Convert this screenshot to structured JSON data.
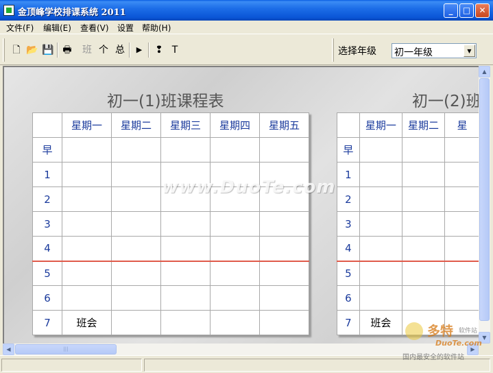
{
  "window": {
    "title": "金顶峰学校排课系统  2011",
    "minimize": "_",
    "maximize": "□",
    "close": "✕"
  },
  "menu": [
    {
      "label": "文件(F)"
    },
    {
      "label": "编辑(E)"
    },
    {
      "label": "查看(V)"
    },
    {
      "label": "设置"
    },
    {
      "label": "帮助(H)"
    }
  ],
  "toolbar": {
    "new": "🗋",
    "open": "📂",
    "save": "💾",
    "print": "🖶",
    "class_view": "班",
    "individual_view": "个",
    "total_view": "总",
    "play": "▶",
    "help": "❢",
    "text": "T",
    "grade_label": "选择年级",
    "grade_value": "初一年级"
  },
  "schedules": [
    {
      "title": "初一(1)班课程表",
      "days": [
        "星期一",
        "星期二",
        "星期三",
        "星期四",
        "星期五"
      ],
      "periods": [
        "早",
        "1",
        "2",
        "3",
        "4",
        "5",
        "6",
        "7"
      ],
      "cells": [
        [
          "",
          "",
          "",
          "",
          ""
        ],
        [
          "",
          "",
          "",
          "",
          ""
        ],
        [
          "",
          "",
          "",
          "",
          ""
        ],
        [
          "",
          "",
          "",
          "",
          ""
        ],
        [
          "",
          "",
          "",
          "",
          ""
        ],
        [
          "",
          "",
          "",
          "",
          ""
        ],
        [
          "",
          "",
          "",
          "",
          ""
        ],
        [
          "班会",
          "",
          "",
          "",
          ""
        ]
      ]
    },
    {
      "title": "初一(2)班",
      "days": [
        "星期一",
        "星期二",
        "星"
      ],
      "periods": [
        "早",
        "1",
        "2",
        "3",
        "4",
        "5",
        "6",
        "7"
      ],
      "cells": [
        [
          "",
          "",
          ""
        ],
        [
          "",
          "",
          ""
        ],
        [
          "",
          "",
          ""
        ],
        [
          "",
          "",
          ""
        ],
        [
          "",
          "",
          ""
        ],
        [
          "",
          "",
          ""
        ],
        [
          "",
          "",
          ""
        ],
        [
          "班会",
          "",
          ""
        ]
      ]
    }
  ],
  "watermark": "www.DuoTe.com",
  "logo": {
    "brand": "多特",
    "tag": "软件站",
    "url": "DuoTe.com",
    "slogan": "国内最安全的软件站"
  },
  "scrollbar": {
    "up": "▲",
    "down": "▼",
    "left": "◀",
    "right": "▶",
    "grip": "|||"
  }
}
